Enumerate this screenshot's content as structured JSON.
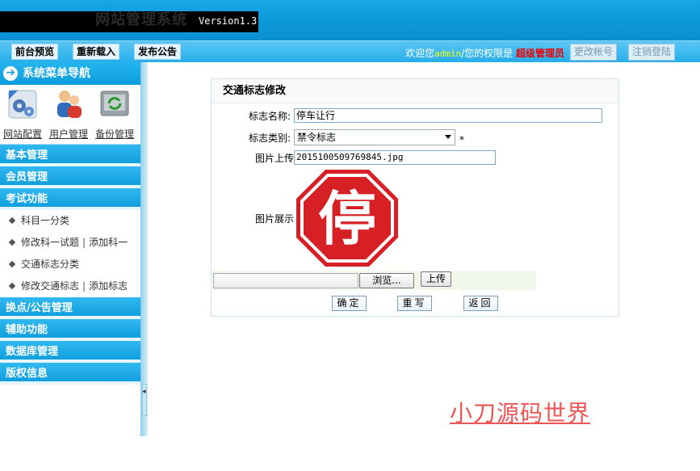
{
  "header": {
    "ghost_title": "网站管理系统",
    "version": "Version1.3"
  },
  "toolbar": {
    "preview": "前台预览",
    "reload": "重新载入",
    "announce": "发布公告",
    "welcome_prefix": "欢迎您",
    "username": "admin",
    "welcome_middle": "/您的权限是",
    "role": "超级管理员",
    "change_account": "更改帐号",
    "logout": "注销登陆"
  },
  "sidebar": {
    "title": "系统菜单导航",
    "quick": [
      {
        "label": "网站配置",
        "icon": "gear-config-icon"
      },
      {
        "label": "用户管理",
        "icon": "users-icon"
      },
      {
        "label": "备份管理",
        "icon": "backup-icon"
      }
    ],
    "sections": {
      "basic": "基本管理",
      "member": "会员管理",
      "exam": "考试功能",
      "points": "换点/公告管理",
      "aux": "辅助功能",
      "db": "数据库管理",
      "copyright": "版权信息"
    },
    "exam_items": {
      "item1": "科目一分类",
      "item2a": "修改科一试题",
      "item2b": "添加科一",
      "item3": "交通标志分类",
      "item4a": "修改交通标志",
      "item4b": "添加标志",
      "sep": "|"
    }
  },
  "form": {
    "title": "交通标志修改",
    "name_label": "标志名称:",
    "name_value": "停车让行",
    "type_label": "标志类别:",
    "type_value": "禁令标志",
    "required_mark": "*",
    "upload_label": "图片上传",
    "upload_value": "2015100509769845.jpg",
    "display_label": "图片展示",
    "sign_text": "停",
    "browse": "浏览...",
    "upload_btn": "上传",
    "ok": "确定",
    "reset": "重写",
    "back": "返回"
  },
  "watermark": "小刀源码世界",
  "colors": {
    "header_blue": "#0b97d9",
    "sign_red": "#d71f26",
    "role_red": "#e00000",
    "watermark": "#e55555"
  }
}
